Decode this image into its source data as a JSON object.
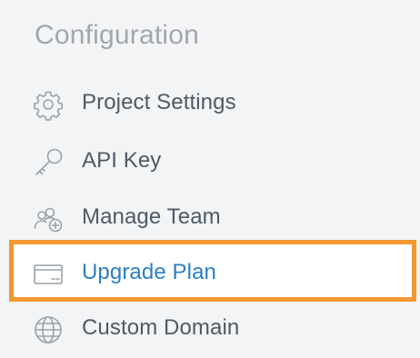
{
  "section": {
    "title": "Configuration"
  },
  "nav": {
    "items": [
      {
        "label": "Project Settings",
        "icon": "gear-icon",
        "active": false
      },
      {
        "label": "API Key",
        "icon": "key-icon",
        "active": false
      },
      {
        "label": "Manage Team",
        "icon": "team-add-icon",
        "active": false
      },
      {
        "label": "Upgrade Plan",
        "icon": "credit-card-icon",
        "active": true
      },
      {
        "label": "Custom Domain",
        "icon": "globe-icon",
        "active": false
      }
    ]
  },
  "colors": {
    "background": "#f3f4f5",
    "text": "#4e5a66",
    "section_title": "#a3a7ab",
    "active_text": "#2b7fc4",
    "highlight_border": "#f3982e",
    "icon_stroke": "#9aa1a8"
  }
}
